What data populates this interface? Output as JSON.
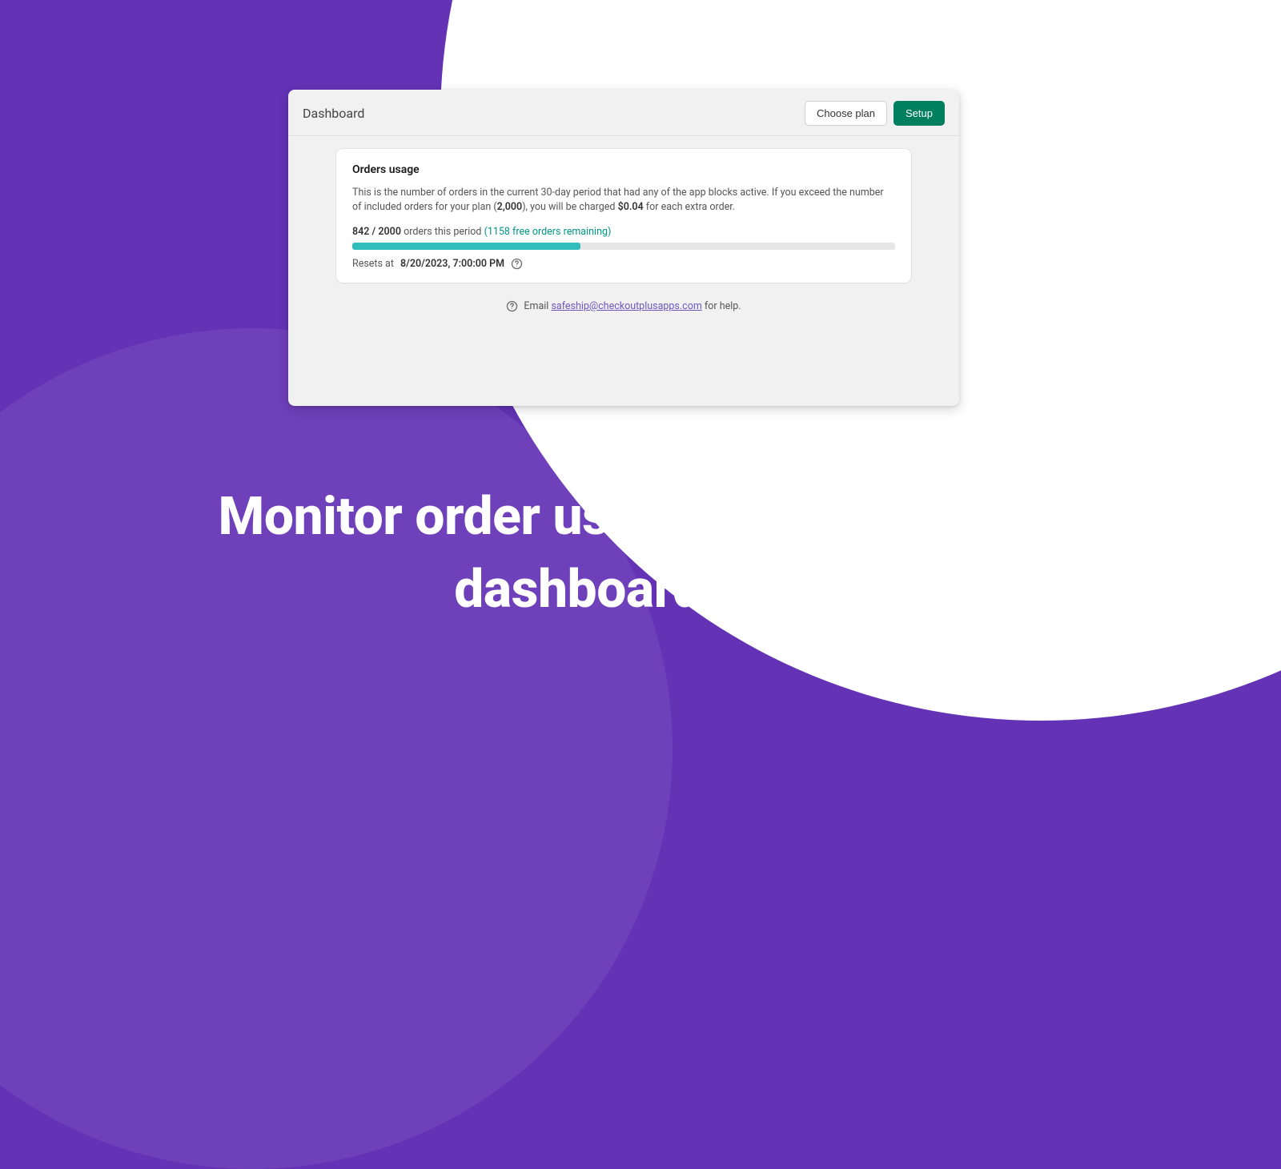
{
  "marketing": {
    "caption": "Monitor order usage in the app dashboard"
  },
  "dashboard": {
    "title": "Dashboard",
    "actions": {
      "choose_plan": "Choose plan",
      "setup": "Setup"
    },
    "card": {
      "title": "Orders usage",
      "desc_part1": "This is the number of orders in the current 30-day period that had any of the app blocks active. If you exceed the number of included orders for your plan (",
      "plan_included": "2,000",
      "desc_part2": "), you will be charged ",
      "extra_cost": "$0.04",
      "desc_part3": " for each extra order.",
      "used": 842,
      "total": 2000,
      "used_total_str": "842 / 2000",
      "period_label": " orders this period ",
      "remaining_str": "(1158 free orders remaining)",
      "progress_pct": 42.1,
      "reset_prefix": "Resets at ",
      "reset_at": "8/20/2023, 7:00:00 PM"
    },
    "help": {
      "prefix": "Email ",
      "email": "safeship@checkoutplusapps.com",
      "suffix": " for help."
    }
  },
  "colors": {
    "brand_purple": "#6332B5",
    "primary_green": "#007F5F",
    "teal": "#32BDBD",
    "link": "#6B57BE"
  }
}
